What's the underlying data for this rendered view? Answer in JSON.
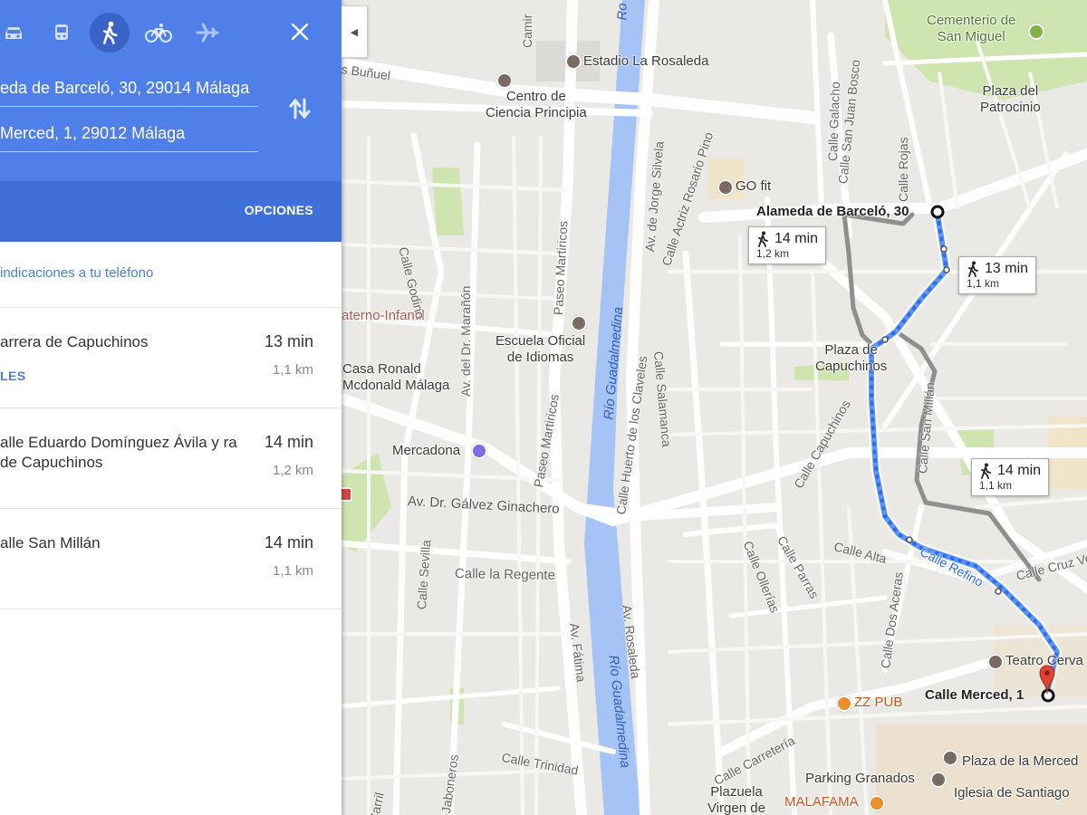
{
  "sidebar": {
    "modes": [
      {
        "name": "car-mode",
        "icon": "car-icon",
        "active": false
      },
      {
        "name": "transit-mode",
        "icon": "bus-icon",
        "active": false
      },
      {
        "name": "walk-mode",
        "icon": "walk-icon",
        "active": true
      },
      {
        "name": "bike-mode",
        "icon": "bicycle-icon",
        "active": false
      },
      {
        "name": "flight-mode",
        "icon": "plane-icon",
        "active": false
      }
    ],
    "origin": "eda de Barceló, 30, 29014 Málaga",
    "destination": "Merced, 1, 29012 Málaga",
    "options_label": "OPCIONES",
    "send_label": "indicaciones a tu teléfono",
    "routes": [
      {
        "via": "arrera de Capuchinos",
        "time": "13 min",
        "distance": "1,1 km",
        "details": "LES"
      },
      {
        "via": "alle Eduardo Domínguez Ávila y ra de Capuchinos",
        "time": "14 min",
        "distance": "1,2 km"
      },
      {
        "via": "alle San Millán",
        "time": "14 min",
        "distance": "1,1 km"
      }
    ],
    "colors": {
      "header": "#4f80e9",
      "options_bar": "#3f6fd8",
      "link": "#4a7fd8"
    }
  },
  "map": {
    "places": {
      "cementerio": "Cementerio de\nSan Miguel",
      "plaza_patrocinio": "Plaza del\nPatrocinio",
      "estadio": "Estadio La Rosaleda",
      "centro_ciencia": "Centro de\nCiencia Principia",
      "gofit": "GO fit",
      "escuela": "Escuela Oficial\nde Idiomas",
      "casa_ronald": "Casa Ronald\nMcdonald Málaga",
      "materno": "aterno-Infantil",
      "mercadona": "Mercadona",
      "plaza_capuchinos": "Plaza de\nCapuchinos",
      "teatro": "Teatro Cerva",
      "zz_pub": "ZZ PUB",
      "parking": "Parking Granados",
      "malafama": "MALAFAMA",
      "plaza_merced": "Plaza de la Merced",
      "iglesia": "Iglesia de Santiago",
      "plazuela": "Plazuela\nVirgen de"
    },
    "streets": {
      "bunuel": "s Buñuel",
      "camino": "Camir",
      "godino": "Calle Godino",
      "maranon": "Av. del Dr. Marañón",
      "martiricos1": "Paseo Martiricos",
      "martiricos2": "Paseo Martiricos",
      "jorge_silvela": "Av. de Jorge Silvela",
      "rosario_pino": "Calle Actriz Rosario Pino",
      "galacho": "Calle Galacho",
      "san_juan_bosco": "Calle San Juan Bosco",
      "rojas": "Calle Rojas",
      "huerto": "Calle Huerto de los Claveles",
      "salamanca": "Calle Salamanca",
      "galvez": "Av. Dr. Gálvez Ginachero",
      "sevilla": "Calle Sevilla",
      "regente": "Calle la Regente",
      "fatima": "Av. Fátima",
      "rosaleda": "Av. Rosaleda",
      "capuchinos": "Calle Capuchinos",
      "san_millan": "Calle San Millán",
      "olleras": "Calle Ollerías",
      "parras": "Calle Parras",
      "alta": "Calle Alta",
      "refino": "Calle Refino",
      "cruz_verde": "Calle Cruz Ve",
      "dos_aceras": "Calle Dos Aceras",
      "carreteria": "Calle Carretería",
      "trinidad": "Calle Trinidad",
      "jaboneros": "Jaboneros",
      "carril": "Carril"
    },
    "river_labels": [
      "Río Guadalmedina",
      "Río Guadalmedina"
    ],
    "river_top": "Ro",
    "origin_label": "Alameda de Barceló, 30",
    "destination_label": "Calle Merced, 1",
    "route_cards": [
      {
        "time": "14 min",
        "distance": "1,2 km"
      },
      {
        "time": "13 min",
        "distance": "1,1 km"
      },
      {
        "time": "14 min",
        "distance": "1,1 km"
      }
    ],
    "colors": {
      "route_selected": "#4285f4",
      "route_alt": "#8f8f8f",
      "river": "#a6c3f5",
      "park": "#cfe5b0"
    }
  }
}
